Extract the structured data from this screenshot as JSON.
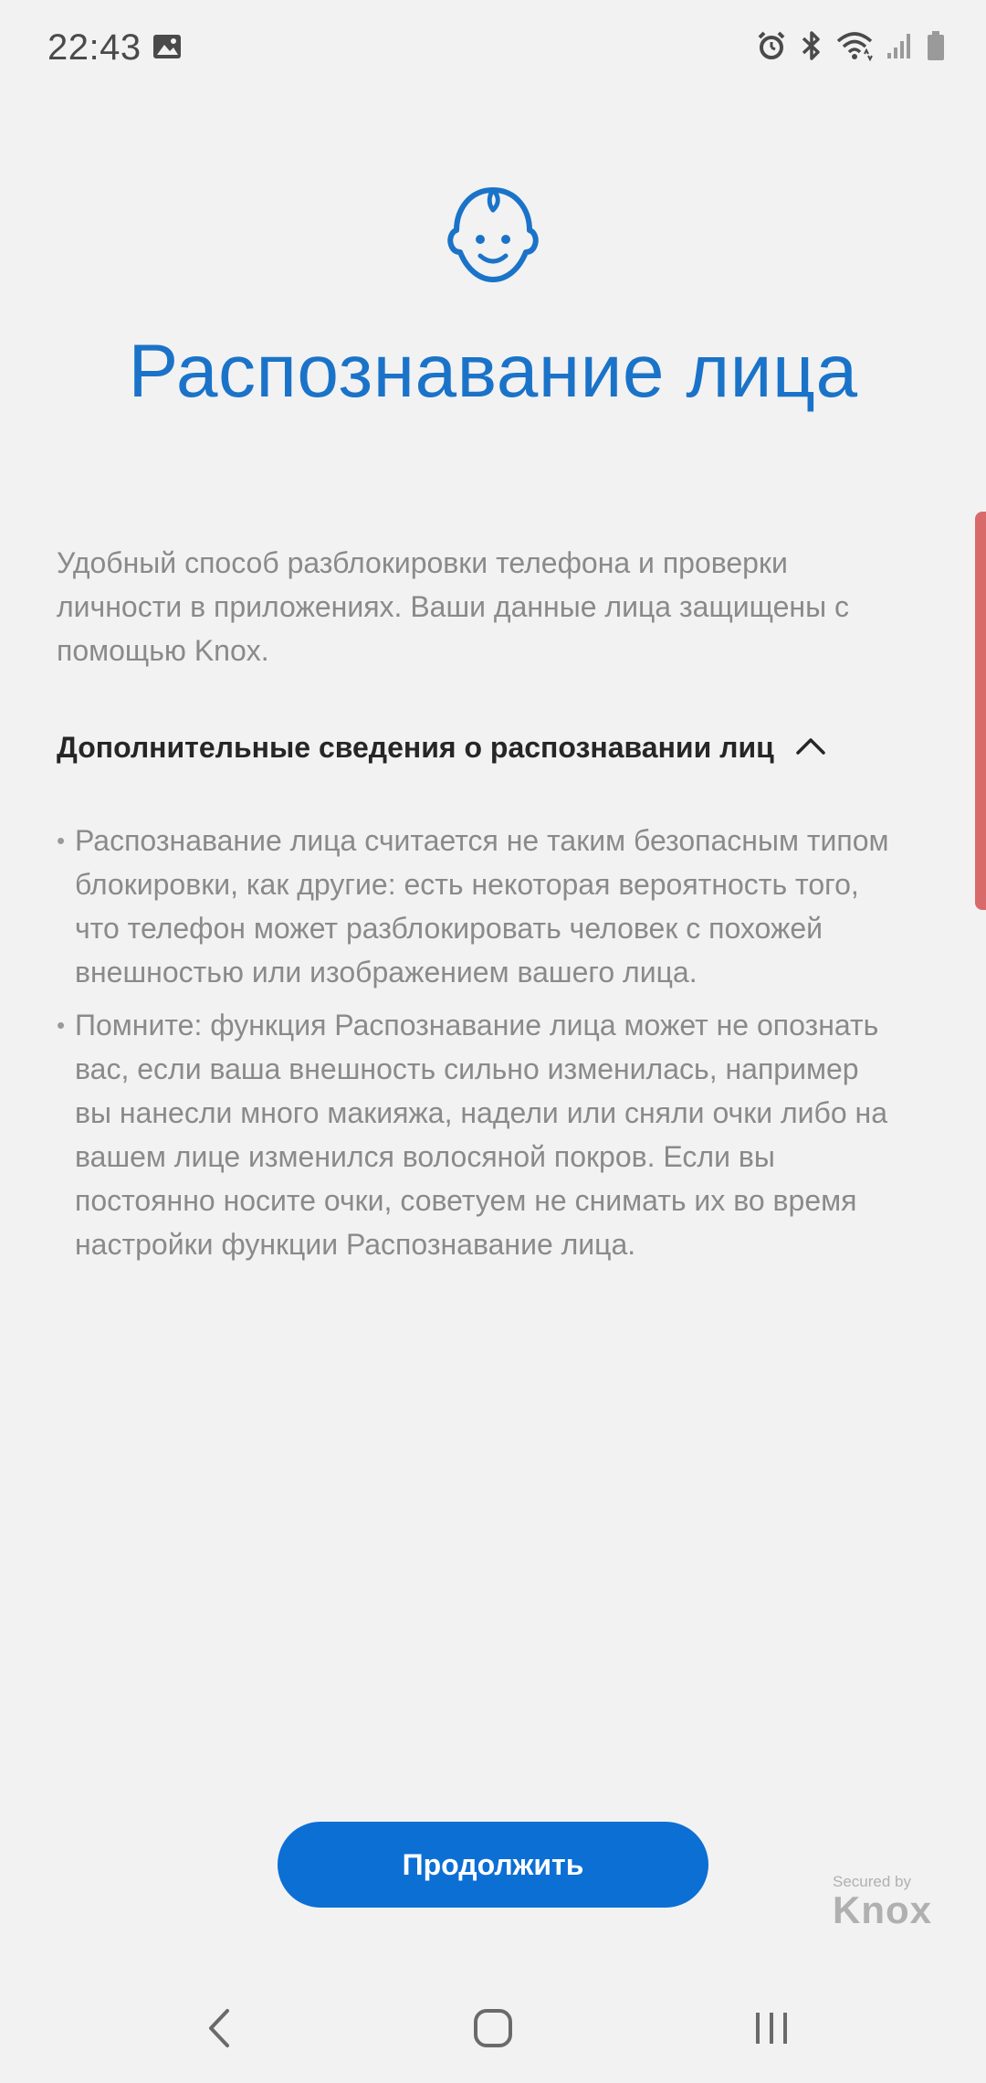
{
  "status_bar": {
    "time": "22:43",
    "icons": [
      "gallery-icon",
      "alarm-icon",
      "bluetooth-icon",
      "wifi-icon",
      "signal-icon",
      "battery-icon"
    ]
  },
  "hero": {
    "icon": "face-icon",
    "title": "Распознавание лица"
  },
  "intro": {
    "text": "Удобный способ разблокировки телефона и проверки личности в приложениях. Ваши данные лица защищены с помощью Knox."
  },
  "details": {
    "title": "Дополнительные сведения о распознавании лиц",
    "expanded": true,
    "bullets": [
      "Распознавание лица считается не таким безопасным типом блокировки, как другие: есть некоторая вероятность того, что телефон может разблокировать человек с похожей внешностью или изображением вашего лица.",
      "Помните: функция Распознавание лица может не опознать вас, если ваша внешность сильно изменилась, например вы нанесли много макияжа, надели или сняли очки либо на вашем лице изменился волосяной покров. Если вы постоянно носите очки, советуем не снимать их во время настройки функции Распознавание лица."
    ]
  },
  "actions": {
    "continue_label": "Продолжить"
  },
  "branding": {
    "secured_by": "Secured by",
    "knox": "Knox"
  },
  "nav": {
    "icons": [
      "back-icon",
      "home-icon",
      "recents-icon"
    ]
  },
  "colors": {
    "accent": "#1a73c8",
    "button": "#0b6fd4",
    "background": "#f2f2f2",
    "body_text": "#8a8a8a"
  }
}
